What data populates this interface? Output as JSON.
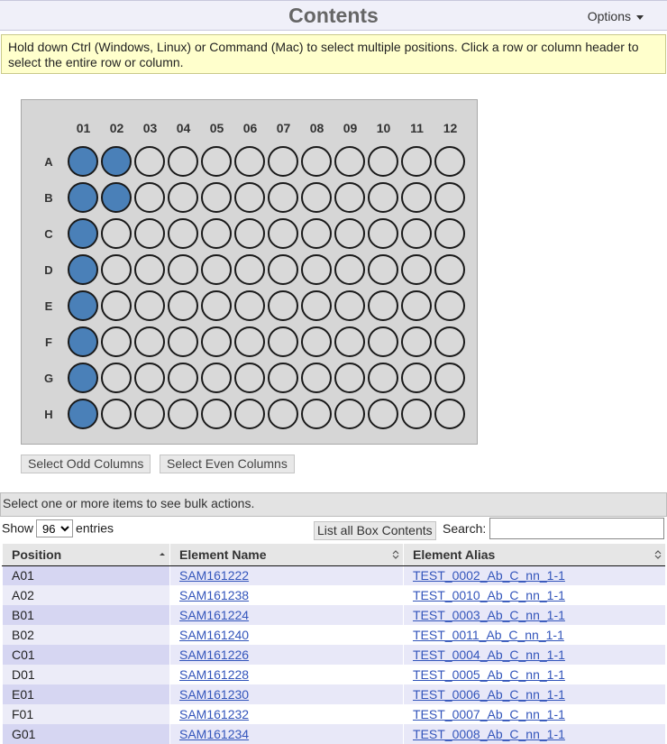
{
  "header": {
    "title": "Contents",
    "options_label": "Options"
  },
  "notice": "Hold down Ctrl (Windows, Linux) or Command (Mac) to select multiple positions. Click a row or column header to select the entire row or column.",
  "plate": {
    "columns": [
      "01",
      "02",
      "03",
      "04",
      "05",
      "06",
      "07",
      "08",
      "09",
      "10",
      "11",
      "12"
    ],
    "rows": [
      "A",
      "B",
      "C",
      "D",
      "E",
      "F",
      "G",
      "H"
    ],
    "filled": [
      "A01",
      "A02",
      "B01",
      "B02",
      "C01",
      "D01",
      "E01",
      "F01",
      "G01",
      "H01"
    ],
    "colors": {
      "filled": "#4a80b8",
      "empty": "#d9d9d9"
    }
  },
  "buttons": {
    "select_odd": "Select Odd Columns",
    "select_even": "Select Even Columns"
  },
  "bulk_message": "Select one or more items to see bulk actions.",
  "table_controls": {
    "show_label": "Show",
    "entries_value": "96",
    "entries_label": "entries",
    "list_all": "List all Box Contents",
    "search_label": "Search:",
    "search_value": ""
  },
  "table": {
    "headers": [
      "Position",
      "Element Name",
      "Element Alias"
    ],
    "rows": [
      {
        "position": "A01",
        "name": "SAM161222",
        "alias": "TEST_0002_Ab_C_nn_1-1"
      },
      {
        "position": "A02",
        "name": "SAM161238",
        "alias": "TEST_0010_Ab_C_nn_1-1"
      },
      {
        "position": "B01",
        "name": "SAM161224",
        "alias": "TEST_0003_Ab_C_nn_1-1"
      },
      {
        "position": "B02",
        "name": "SAM161240",
        "alias": "TEST_0011_Ab_C_nn_1-1"
      },
      {
        "position": "C01",
        "name": "SAM161226",
        "alias": "TEST_0004_Ab_C_nn_1-1"
      },
      {
        "position": "D01",
        "name": "SAM161228",
        "alias": "TEST_0005_Ab_C_nn_1-1"
      },
      {
        "position": "E01",
        "name": "SAM161230",
        "alias": "TEST_0006_Ab_C_nn_1-1"
      },
      {
        "position": "F01",
        "name": "SAM161232",
        "alias": "TEST_0007_Ab_C_nn_1-1"
      },
      {
        "position": "G01",
        "name": "SAM161234",
        "alias": "TEST_0008_Ab_C_nn_1-1"
      }
    ]
  }
}
